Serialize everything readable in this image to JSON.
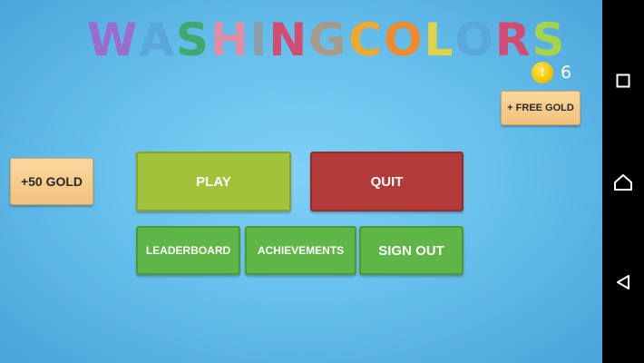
{
  "title": {
    "letters": [
      {
        "char": "W",
        "color": "#9b6bd0"
      },
      {
        "char": "A",
        "color": "#5aa7e0"
      },
      {
        "char": "S",
        "color": "#3ea86e"
      },
      {
        "char": "H",
        "color": "#e08ea8"
      },
      {
        "char": "I",
        "color": "#8e9ea8"
      },
      {
        "char": "N",
        "color": "#d24c72"
      },
      {
        "char": "G",
        "color": "#a89a86"
      },
      {
        "char": " ",
        "color": ""
      },
      {
        "char": "C",
        "color": "#f0a92e"
      },
      {
        "char": "O",
        "color": "#f08a2e"
      },
      {
        "char": "L",
        "color": "#e0d24a"
      },
      {
        "char": "O",
        "color": "#5aa7e0"
      },
      {
        "char": "R",
        "color": "#d24c72"
      },
      {
        "char": "S",
        "color": "#a6d24c"
      }
    ]
  },
  "currency": {
    "coin_symbol": "!",
    "count": "6"
  },
  "buttons": {
    "free_gold": "+ FREE GOLD",
    "plus_50_gold": "+50 GOLD",
    "play": "PLAY",
    "quit": "QUIT",
    "leaderboard": "LEADERBOARD",
    "achievements": "ACHIEVEMENTS",
    "sign_out": "SIGN OUT"
  },
  "colors": {
    "background": "#6cc4ef",
    "play": "#a2c23c",
    "quit": "#b53b3b",
    "green": "#5fb545",
    "gold": "#f6cd8e",
    "navbar": "#000000"
  },
  "navbar": {
    "icons": [
      "recent-apps-icon",
      "home-icon",
      "back-icon"
    ]
  }
}
